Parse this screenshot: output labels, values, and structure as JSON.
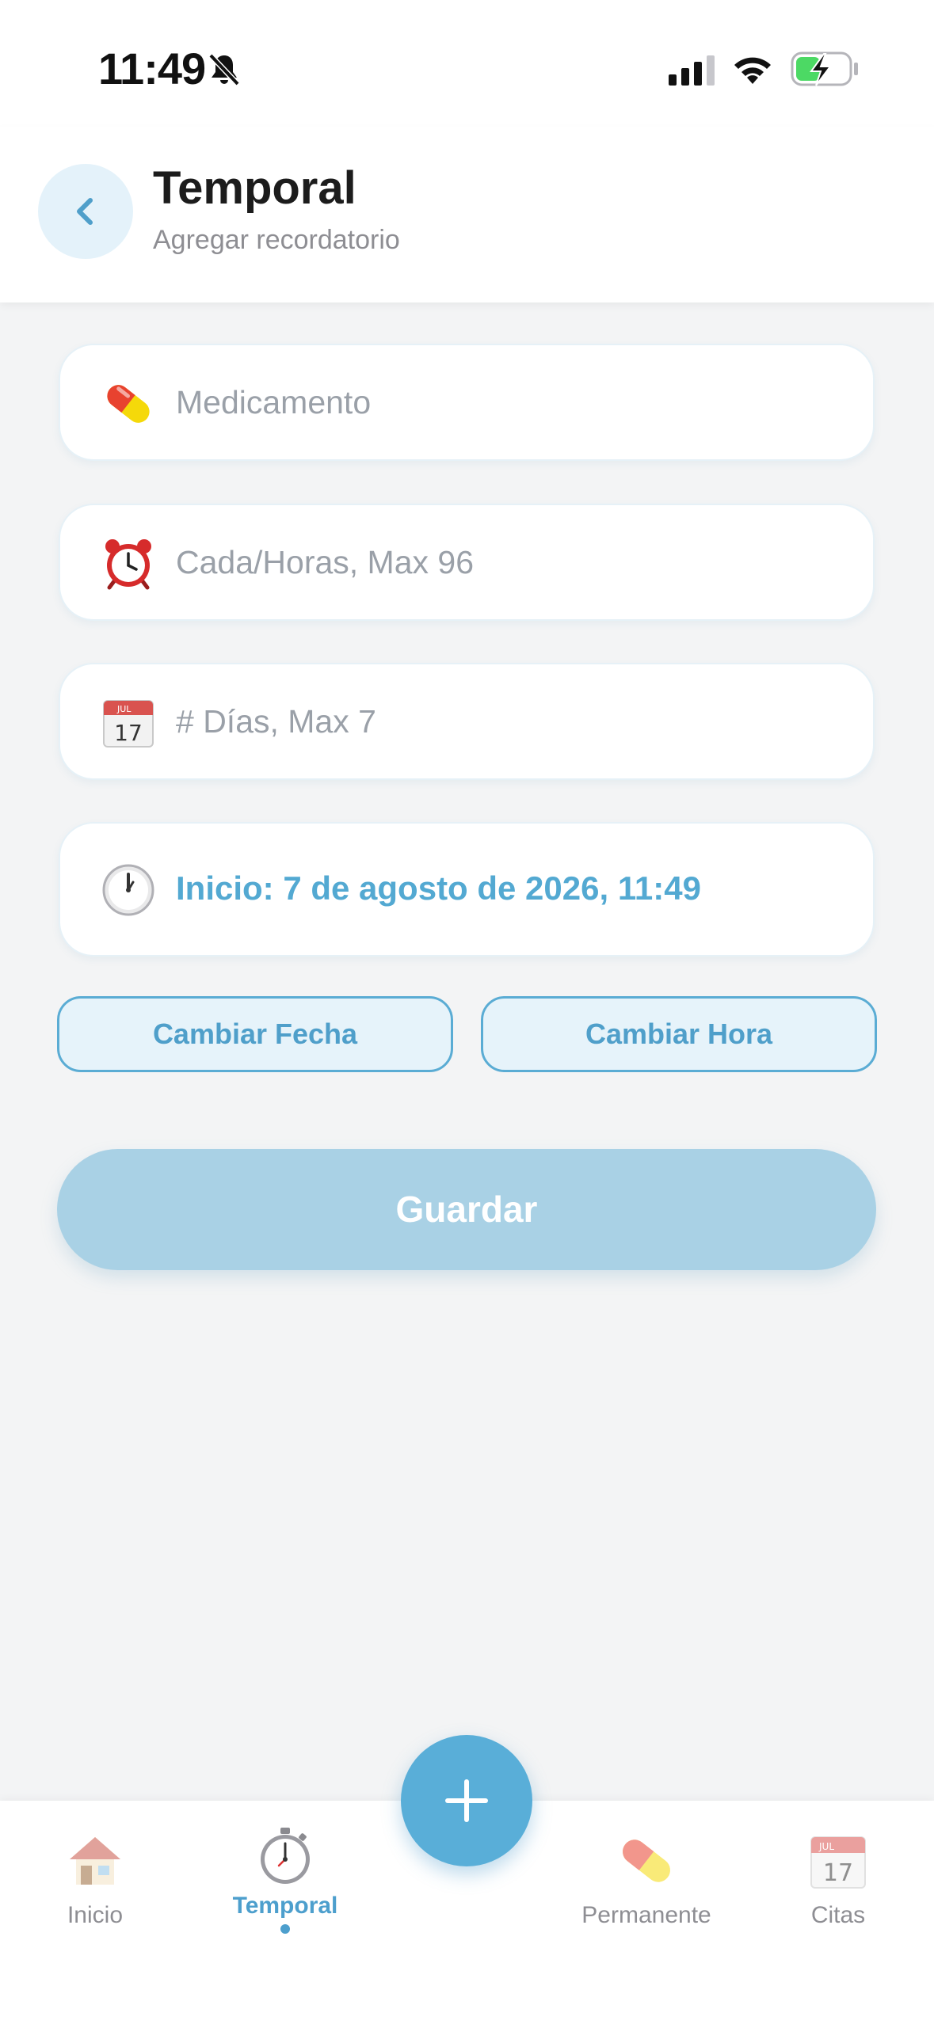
{
  "status_bar": {
    "time": "11:49"
  },
  "header": {
    "title": "Temporal",
    "subtitle": "Agregar recordatorio"
  },
  "form": {
    "medication": {
      "placeholder": "Medicamento",
      "value": "",
      "icon": "pill-icon"
    },
    "interval_hours": {
      "placeholder": "Cada/Horas, Max 96",
      "value": "",
      "icon": "alarm-clock-icon"
    },
    "days": {
      "placeholder": "# Días, Max 7",
      "value": "",
      "icon": "calendar-icon"
    },
    "start": {
      "text": "Inicio: 7 de agosto de 2026, 11:49",
      "icon": "clock-icon"
    },
    "change_date_label": "Cambiar Fecha",
    "change_time_label": "Cambiar Hora",
    "save_label": "Guardar"
  },
  "tab_bar": {
    "tabs": [
      {
        "label": "Inicio",
        "icon": "house-icon",
        "active": false
      },
      {
        "label": "Temporal",
        "icon": "stopwatch-icon",
        "active": true
      },
      {
        "label": "Permanente",
        "icon": "pill-icon",
        "active": false
      },
      {
        "label": "Citas",
        "icon": "calendar-icon",
        "active": false
      }
    ],
    "fab_icon": "plus-icon"
  },
  "colors": {
    "accent": "#59aed8",
    "accent_text": "#4f9fca",
    "save_disabled": "#a9d1e5",
    "background": "#f3f4f5"
  }
}
